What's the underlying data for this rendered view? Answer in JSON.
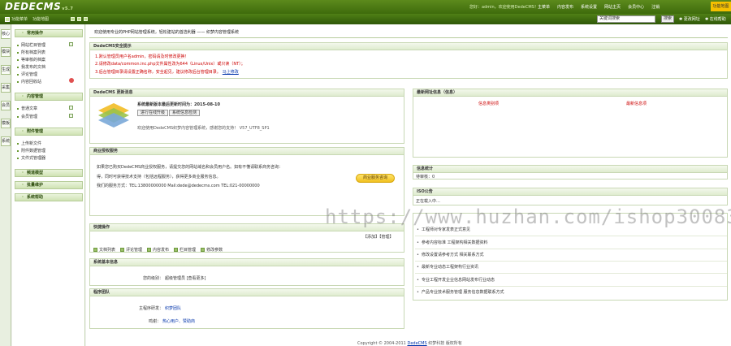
{
  "app": {
    "logo": "DEDECMS",
    "version": "v5.7"
  },
  "topbar": {
    "user_text": "您好：admin，欢迎使用DedeCMS！",
    "nav": [
      "主菜单",
      "内容发布",
      "系统设置",
      "网站主页",
      "会员中心",
      "注销"
    ],
    "highlight": "功能地图"
  },
  "subbar": {
    "left_items": [
      "功能菜单",
      "功能地图"
    ],
    "search_value": "关键词搜索",
    "search_button": "搜索",
    "link_a": "更改网址",
    "link_b": "在线帮助"
  },
  "vtabs": [
    "核心",
    "模块",
    "生成",
    "采集",
    "会员",
    "模板",
    "系统"
  ],
  "leftmenu": {
    "group_main": "常用操作",
    "main_items": [
      "网站栏目管理",
      "所有档案列表",
      "等审核的档案",
      "我发布的文档",
      "评论管理",
      "内容回收站"
    ],
    "group_content": "内容管理",
    "content_items": [
      "普通文章",
      "会员管理"
    ],
    "group_attach": "附件管理",
    "attach_items": [
      "上传新文件",
      "附件数据管理",
      "文件式管理器"
    ],
    "group_channel": "频道模型",
    "group_batch": "批量维护",
    "group_help": "系统帮助"
  },
  "main": {
    "welcome": "欢迎使用专业的PHP网站管理系统，轻松建站的首选利器 —— 织梦内容管理系统"
  },
  "security": {
    "title": "DedeCMS安全提示",
    "lines": [
      "1.默认管理员用户名admin，密码请及时修改更换！",
      "2.请修改data/common.inc.php文件属性改为644（Linux/Unix）或只读（NT）；",
      "3.后台管理目录请设置正确名称，安全起见，建议修改后台管理目录。"
    ],
    "fix_label": "马上修改"
  },
  "version": {
    "title": "DedeCMS 更新消息",
    "latest": "系统最新版本最后更新时间为：2015-08-10",
    "btn_check": "进行在线升级",
    "btn_detail": "系统信息检测",
    "note": "欢迎使用DedeCMS织梦内容管理系统，感谢您的支持！ V57_UTF8_SP1"
  },
  "business": {
    "title": "商业授权服务",
    "lines": [
      "如果您已购买DedeCMS商业授权服务，请提交您的网站域名和会员用户名。如有不懂请联系商务咨询：",
      "得，同时可获得技术支持（包括远程服务），获得更多商业服务信息。",
      "我们的服务方式：TEL:13800000000 Mail:dede@dedecms.com  TEL:021-00000000"
    ],
    "button": "商业服务咨询"
  },
  "quick": {
    "title": "快捷操作",
    "add": "【添加】【管理】",
    "links": [
      "文档列表",
      "评论管理",
      "内容发布",
      "栏目管理",
      "修改参数"
    ]
  },
  "sysinfo": {
    "title": "系统基本信息",
    "label": "您的级别：",
    "value": "超级管理员 [查看更多]"
  },
  "team": {
    "title": "程序团队",
    "label1": "主程序研发：",
    "value1": "织梦团队",
    "label2": "鸣谢：",
    "value2": "热心用户、赞助商"
  },
  "info": {
    "title": "最新网址信息（信息）",
    "link1": "信息类别项",
    "link2": "最新信息项"
  },
  "stats": {
    "title": "信息统计",
    "text": "待审核：0"
  },
  "notice": {
    "title": "ISO公告",
    "text": "正在载入中…"
  },
  "news": {
    "items": [
      "工程师对专家发表正式意见",
      "参考内容标准 工程架构相关数据资料",
      "修改设置请参考方式 相关联系方式",
      "最新专业动态工程架构行业资讯",
      "专业工程开发企业信息网站发布行业动态",
      "产品专业技术服务管理 服务信息数据联系方式"
    ]
  },
  "footer": {
    "copyright": "Copyright © 2004-2011",
    "brand": "DedeCMS",
    "rights": "织梦科技 版权所有"
  },
  "watermark": "https://www.huzhan.com/ishop30083"
}
